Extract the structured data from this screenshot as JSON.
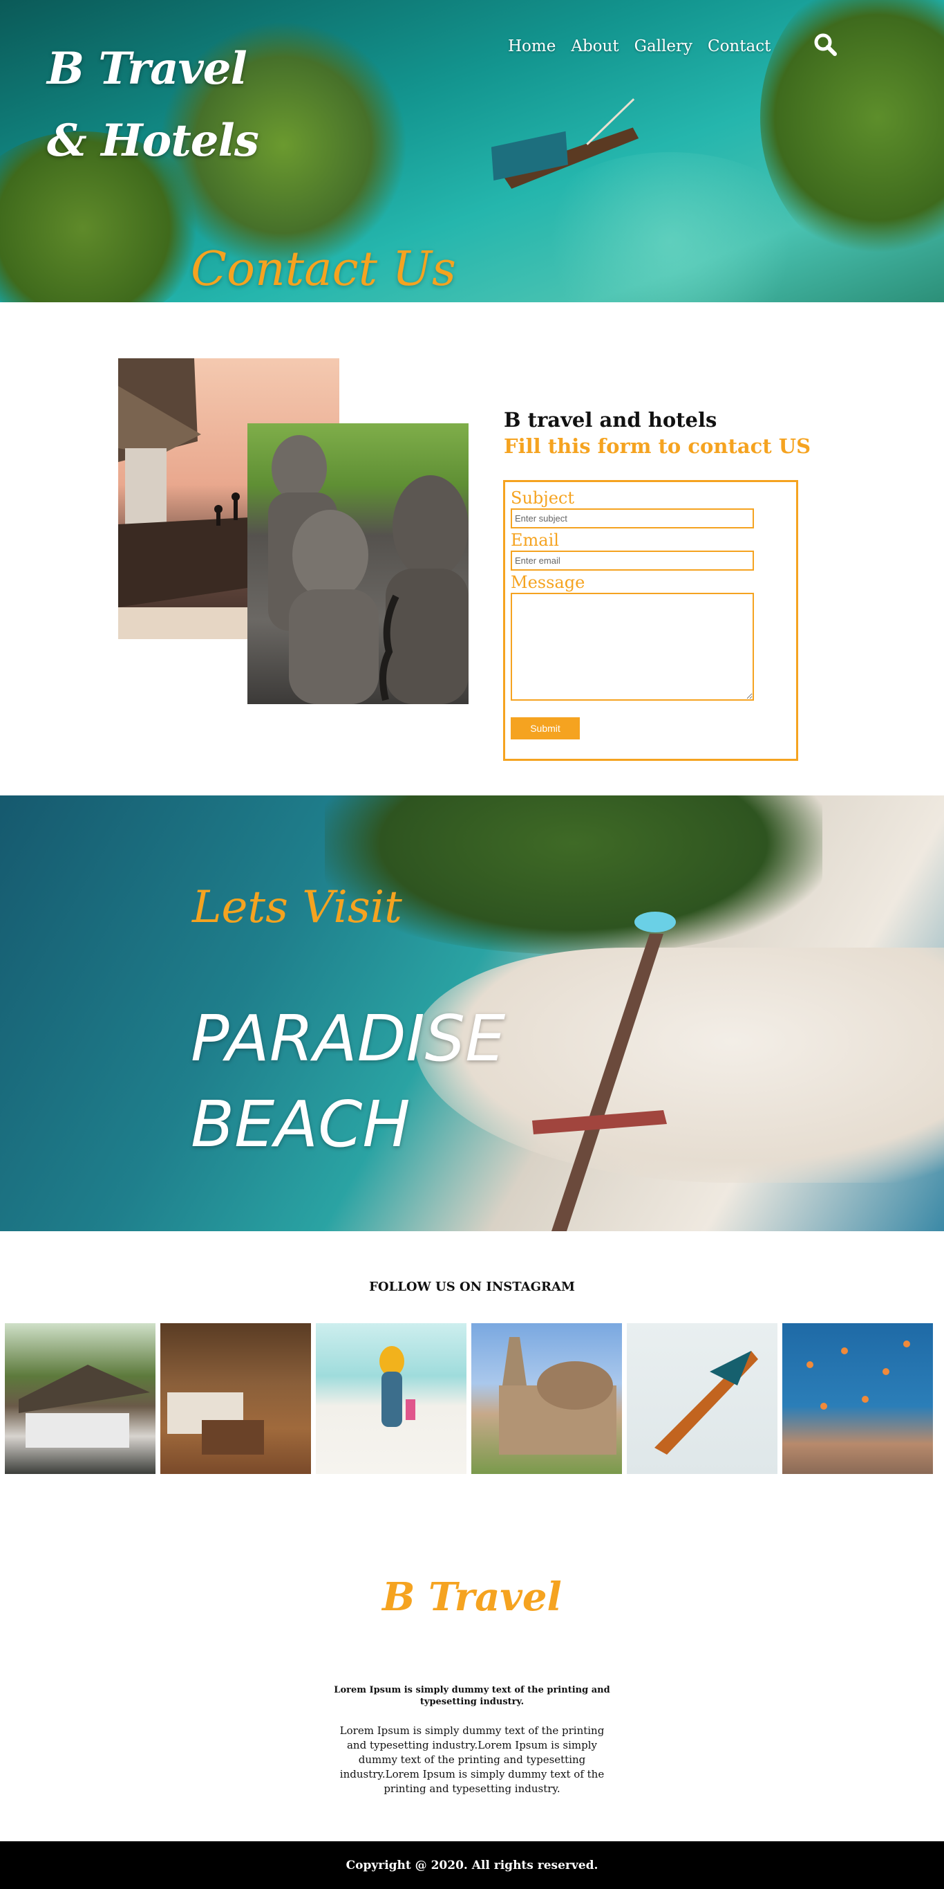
{
  "header": {
    "logo_line1": "B Travel",
    "logo_line2": "& Hotels",
    "nav": [
      "Home",
      "About",
      "Gallery",
      "Contact"
    ],
    "search_icon": "search-icon",
    "hero_title": "Contact Us"
  },
  "contact": {
    "heading": "B travel and hotels",
    "subheading": "Fill this form to contact US",
    "subject_label": "Subject",
    "subject_placeholder": "Enter subject",
    "email_label": "Email",
    "email_placeholder": "Enter email",
    "message_label": "Message",
    "submit_label": "Submit"
  },
  "paradise": {
    "lets_visit": "Lets Visit",
    "line1": "PARADISE",
    "line2": "BEACH"
  },
  "instagram": {
    "title": "FOLLOW US ON INSTAGRAM"
  },
  "footer": {
    "brand": "B Travel",
    "bold_text": "Lorem Ipsum is simply dummy text of the printing and typesetting industry.",
    "body_text": "Lorem Ipsum is simply dummy text of the printing and typesetting industry.Lorem Ipsum is simply dummy text of the printing and typesetting industry.Lorem Ipsum is simply dummy text of the printing and typesetting industry.",
    "copyright": "Copyright @ 2020. All rights reserved."
  },
  "colors": {
    "accent": "#f5a320",
    "footer_bg": "#000000"
  }
}
